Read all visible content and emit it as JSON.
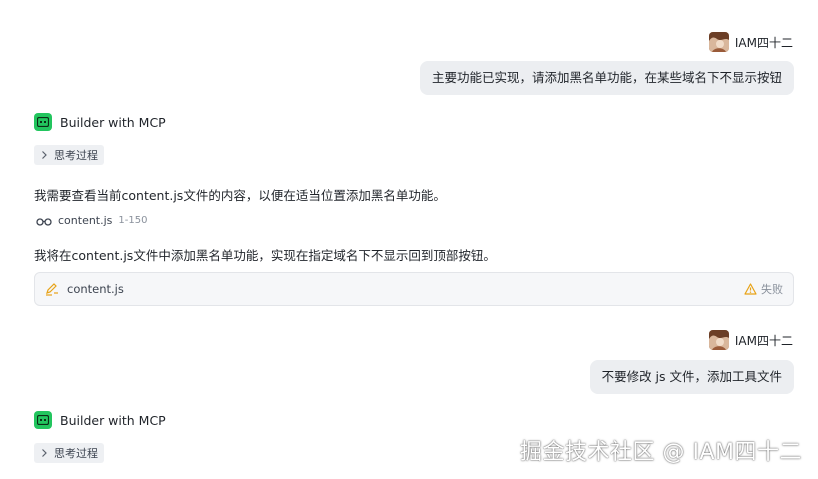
{
  "messages": {
    "user1": {
      "name": "IAM四十二",
      "text": "主要功能已实现，请添加黑名单功能，在某些域名下不显示按钮"
    },
    "bot1": {
      "name": "Builder with MCP",
      "thinking_label": "思考过程",
      "line1": "我需要查看当前content.js文件的内容，以便在适当位置添加黑名单功能。",
      "read_file": "content.js",
      "read_range": "1-150",
      "line2": "我将在content.js文件中添加黑名单功能，实现在指定域名下不显示回到顶部按钮。",
      "edit_file": "content.js",
      "edit_status": "失败"
    },
    "user2": {
      "name": "IAM四十二",
      "text": "不要修改 js 文件，添加工具文件"
    },
    "bot2": {
      "name": "Builder with MCP",
      "thinking_label": "思考过程"
    }
  },
  "watermark": "掘金技术社区 @ IAM四十二",
  "colors": {
    "bot_icon": "#22c55e",
    "bubble_bg": "#eceef1",
    "warning": "#e8a317",
    "edit_icon": "#e8a317"
  }
}
